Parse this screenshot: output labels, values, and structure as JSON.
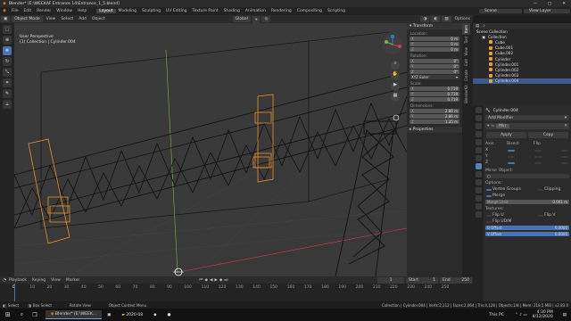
{
  "titlebar": {
    "title": "Blender* [E:\\WEEKAF Entrance 14\\Entrance_1_5.blend]"
  },
  "menus": [
    "File",
    "Edit",
    "Render",
    "Window",
    "Help"
  ],
  "workspaces": [
    "Layout",
    "Modeling",
    "Sculpting",
    "UV Editing",
    "Texture Paint",
    "Shading",
    "Animation",
    "Rendering",
    "Compositing",
    "Scripting"
  ],
  "active_workspace": "Layout",
  "scene": "Scene",
  "view_layer": "View Layer",
  "viewport_header": {
    "mode": "Object Mode",
    "view": "View",
    "select": "Select",
    "add": "Add",
    "object": "Object",
    "orientation": "Orientation",
    "default": "Default",
    "drag": "Drag",
    "select_box": "Select Box",
    "global": "Global",
    "options": "Options"
  },
  "viewport": {
    "view_name": "User Perspective",
    "active": "(1) Collection | Cylinder.004"
  },
  "transform": {
    "title": "Transform",
    "location_label": "Location:",
    "location": {
      "X": "0 m",
      "Y": "0 m",
      "Z": "0 m"
    },
    "rotation_label": "Rotation:",
    "rotation": {
      "X": "0°",
      "Y": "0°",
      "Z": "0°"
    },
    "mode": "XYZ Euler",
    "scale_label": "Scale:",
    "scale": {
      "X": "0.719",
      "Y": "0.719",
      "Z": "0.719"
    },
    "dimensions_label": "Dimensions:",
    "dimensions": {
      "X": "2.86 m",
      "Y": "2.86 m",
      "Z": "1.35 m"
    },
    "properties": "Properties"
  },
  "side_tabs": [
    "Item",
    "Tool",
    "View",
    "Edit",
    "Create",
    "BlenderKit",
    "Animation"
  ],
  "outliner": {
    "root": "Scene Collection",
    "collection": "Collection",
    "items": [
      "Cube",
      "Cube.001",
      "Cube.002",
      "Cylinder",
      "Cylinder.001",
      "Cylinder.002",
      "Cylinder.003",
      "Cylinder.004"
    ],
    "selected": "Cylinder.004"
  },
  "properties": {
    "object": "Cylinder.004",
    "add_modifier": "Add Modifier",
    "modifier_name": "Mirr",
    "apply": "Apply",
    "copy": "Copy",
    "axis": "Axis",
    "bisect": "Bisect",
    "flip": "Flip",
    "axes": [
      "X",
      "Y",
      "Z"
    ],
    "mirror_object": "Mirror Object:",
    "options": "Options:",
    "vertex_groups": "Vertex Groups",
    "clipping": "Clipping",
    "merge": "Merge",
    "merge_limit_label": "Merge Limit",
    "merge_limit": "0.001 m",
    "textures": "Textures:",
    "flip_u": "Flip U",
    "flip_v": "Flip V",
    "flip_udim": "Flip UDIM",
    "u_offset_label": "U Offset",
    "u_offset": "0.0000",
    "v_offset_label": "V Offset",
    "v_offset": "0.0000"
  },
  "timeline": {
    "playback": "Playback",
    "keying": "Keying",
    "view": "View",
    "marker": "Marker",
    "current_frame": "1",
    "start_label": "Start",
    "start": "1",
    "end_label": "End",
    "end": "250",
    "ticks": [
      "0",
      "10",
      "20",
      "30",
      "40",
      "50",
      "60",
      "70",
      "80",
      "90",
      "100",
      "110",
      "120",
      "130",
      "140",
      "150",
      "160",
      "170",
      "180",
      "190",
      "200",
      "210",
      "220",
      "230",
      "240",
      "250"
    ]
  },
  "status": {
    "left": "Select",
    "mid": "Box Select",
    "rot": "Rotate View",
    "ctx": "Object Context Menu",
    "info": "Collection | Cylinder.004 | Verts:2,112 | Faces:2,064 | Tris:4,128 | Objects:1/8 | Mem: 218.5 MiB | v2.83.0"
  },
  "taskbar": {
    "apps": [
      "Blender* [E:\\WEEK...",
      "2020-08"
    ],
    "this_pc": "This PC",
    "time": "4:30 PM",
    "date": "8/12/2020"
  },
  "colors": {
    "accent": "#4772b3",
    "selection": "#e6902a",
    "wire": "#111111",
    "x_axis": "#d33a4a",
    "y_axis": "#7ab83a"
  }
}
